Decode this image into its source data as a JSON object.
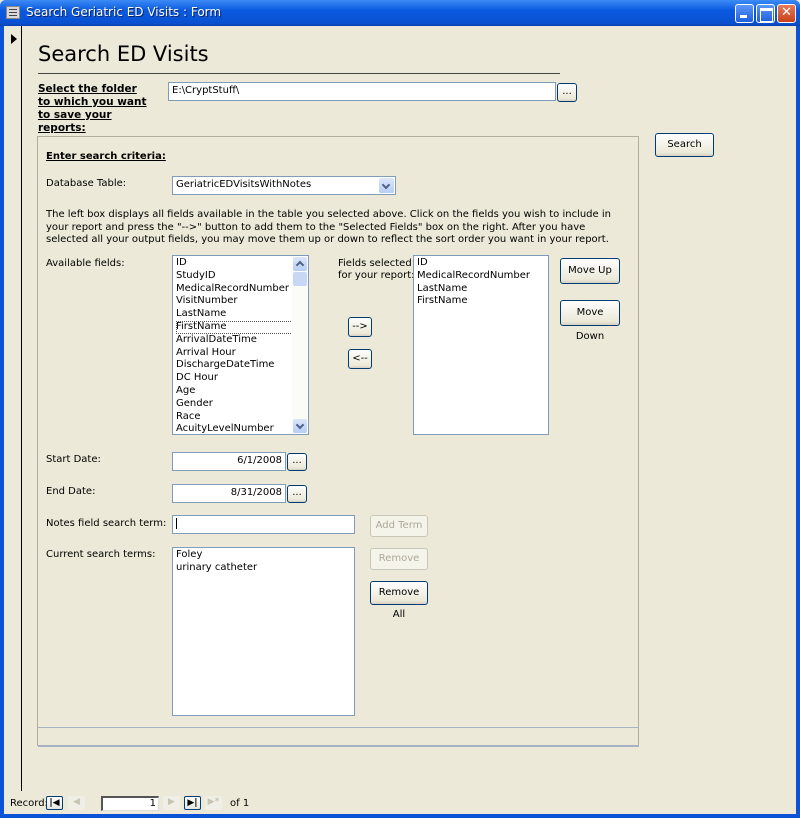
{
  "window": {
    "title": "Search Geriatric ED Visits : Form",
    "controls": [
      "minimize",
      "maximize",
      "close"
    ]
  },
  "form": {
    "heading": "Search ED Visits",
    "folder": {
      "label": "Select the folder to which you want to save your reports:",
      "value": "E:\\CryptStuff\\",
      "browse_label": "..."
    },
    "search_button": "Search",
    "criteria": {
      "section_label": "Enter search criteria:",
      "table_label": "Database Table:",
      "table_value": "GeriatricEDVisitsWithNotes",
      "instructions": "The left box displays all fields available in the table you selected above.  Click on the fields you wish to include in your report and press the \"-->\" button to add them to the \"Selected Fields\" box on the right.  After you have selected all your output fields, you may move them up or down to reflect the sort order you want in your report.",
      "available_label": "Available fields:",
      "available_fields": [
        "ID",
        "StudyID",
        "MedicalRecordNumber",
        "VisitNumber",
        "LastName",
        "FirstName",
        "ArrivalDateTime",
        "Arrival Hour",
        "DischargeDateTime",
        "DC Hour",
        "Age",
        "Gender",
        "Race",
        "AcuityLevelNumber"
      ],
      "focused_field": "FirstName",
      "add_button": "-->",
      "remove_button": "<--",
      "selected_label": "Fields selected for your report:",
      "selected_fields": [
        "ID",
        "MedicalRecordNumber",
        "LastName",
        "FirstName"
      ],
      "move_up": "Move Up",
      "move_down": "Move Down",
      "start_date_label": "Start Date:",
      "start_date": "6/1/2008",
      "end_date_label": "End Date:",
      "end_date": "8/31/2008",
      "date_picker_label": "...",
      "notes_term_label": "Notes field search term:",
      "notes_term_value": "",
      "add_term": "Add Term",
      "current_terms_label": "Current search terms:",
      "current_terms": [
        "Foley",
        "urinary catheter"
      ],
      "remove_term": "Remove",
      "remove_all": "Remove All"
    }
  },
  "navigation": {
    "label": "Record:",
    "current": "1",
    "of_text": "of 1",
    "first_icon": "first-record-icon",
    "prev_icon": "previous-record-icon",
    "next_icon": "next-record-icon",
    "last_icon": "last-record-icon",
    "new_icon": "new-record-icon"
  }
}
